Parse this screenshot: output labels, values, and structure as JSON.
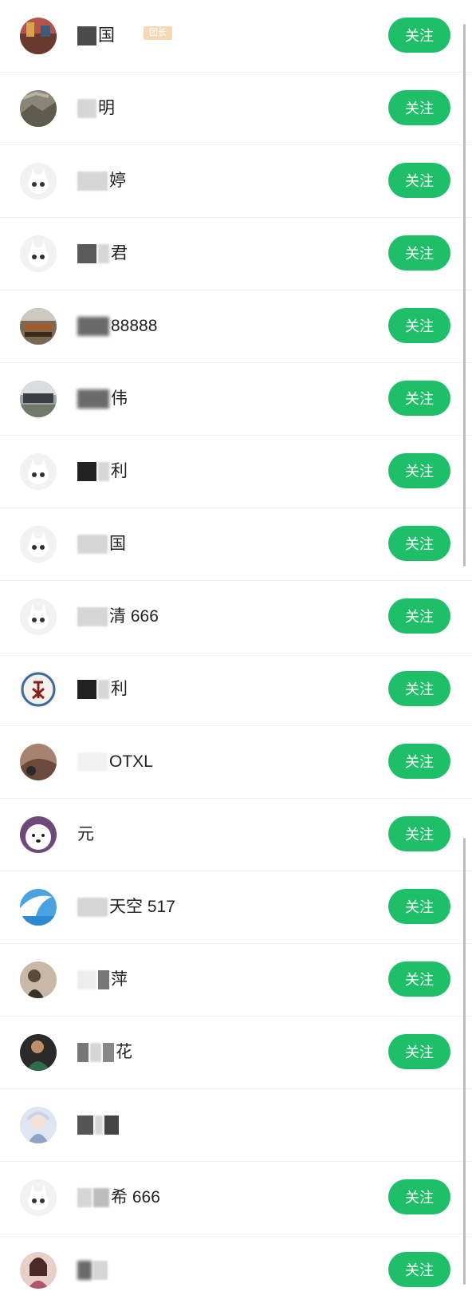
{
  "follow_label": "关注",
  "leader_badge": "团长",
  "rows": [
    {
      "name": "国",
      "avatar": "photo",
      "badge": true,
      "follow": true
    },
    {
      "name": "明",
      "avatar": "photo",
      "follow": true
    },
    {
      "name": "婷",
      "avatar": "default",
      "follow": true
    },
    {
      "name": "君",
      "avatar": "default",
      "follow": true
    },
    {
      "name": "88888",
      "avatar": "photo",
      "follow": true
    },
    {
      "name": "伟",
      "avatar": "photo",
      "follow": true
    },
    {
      "name": "利",
      "avatar": "default",
      "follow": true
    },
    {
      "name": "国",
      "avatar": "default",
      "follow": true
    },
    {
      "name": "清 666",
      "avatar": "default",
      "follow": true
    },
    {
      "name": "利",
      "avatar": "photo",
      "follow": true
    },
    {
      "name": "OTXL",
      "avatar": "photo",
      "follow": true
    },
    {
      "name": "元",
      "avatar": "photo",
      "follow": true
    },
    {
      "name": "天空 517",
      "avatar": "photo",
      "follow": true
    },
    {
      "name": "萍",
      "avatar": "photo",
      "follow": true
    },
    {
      "name": "花",
      "avatar": "photo",
      "follow": true
    },
    {
      "name": "",
      "avatar": "photo",
      "follow": false
    },
    {
      "name": "希 666",
      "avatar": "default",
      "follow": true
    },
    {
      "name": "",
      "avatar": "photo",
      "follow": true
    }
  ],
  "colors": {
    "accent": "#1fbf6a",
    "badge": "#f6d9b4"
  }
}
